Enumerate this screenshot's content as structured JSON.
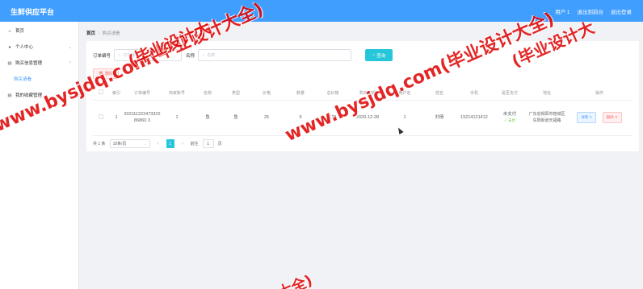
{
  "header": {
    "title": "生鲜供应平台",
    "user": "用户 1",
    "backstage": "退出到前台",
    "logout": "退出登录"
  },
  "sidebar": {
    "items": [
      {
        "label": "首页",
        "icon": "home-icon"
      },
      {
        "label": "个人中心",
        "icon": "user-icon"
      },
      {
        "label": "购买信息管理",
        "icon": "cart-icon"
      },
      {
        "label": "购买请看",
        "icon": ""
      },
      {
        "label": "我的收藏管理",
        "icon": "star-icon"
      }
    ]
  },
  "breadcrumb": {
    "home": "首页",
    "sep": "/",
    "current": "购买请看"
  },
  "search": {
    "order_label": "订单编号",
    "order_placeholder": "订单编号",
    "name_label": "名称",
    "name_placeholder": "名称",
    "type_label": "类型",
    "query_label": "查询",
    "delete_label": "删除"
  },
  "table": {
    "headers": [
      "",
      "索引",
      "订单编号",
      "商家账号",
      "名称",
      "类型",
      "价格",
      "数量",
      "总价格",
      "购买日期",
      "用户名",
      "姓名",
      "手机",
      "是否支付",
      "地址",
      "操作"
    ],
    "rows": [
      {
        "index": "1",
        "order_no": "20211122247332286860 3",
        "merchant": "1",
        "name": "鱼",
        "type": "鱼",
        "price": "25",
        "qty": "5",
        "total": "125",
        "date": "2020-12-28",
        "username": "1",
        "realname": "刘倩",
        "phone": "15214121412",
        "paid": "未支付",
        "pay_link": "支付",
        "address": "广东省揭阳市榕城区东阳街道天福路",
        "edit": "详情",
        "delete": "删除"
      }
    ]
  },
  "pager": {
    "total": "共 1 条",
    "size": "10条/页",
    "prev": "<",
    "page": "1",
    "next": ">",
    "goto": "前往",
    "goto_page": "1",
    "page_suffix": "页"
  },
  "watermark": {
    "text1": "www.bysjdq.com(毕业设计大全)",
    "text2": "(毕业设计大",
    "text3": "大全)"
  }
}
